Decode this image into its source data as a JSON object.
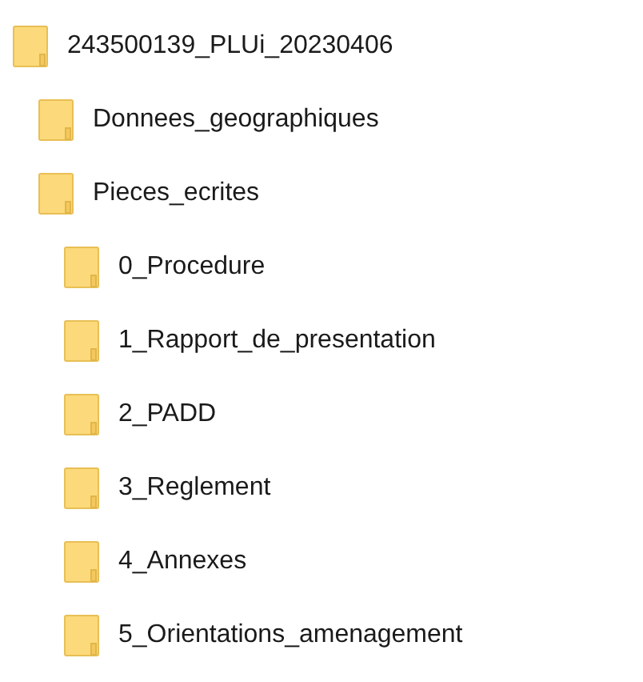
{
  "tree": [
    {
      "label": "243500139_PLUi_20230406",
      "children": [
        {
          "label": "Donnees_geographiques"
        },
        {
          "label": "Pieces_ecrites",
          "children": [
            {
              "label": "0_Procedure"
            },
            {
              "label": "1_Rapport_de_presentation"
            },
            {
              "label": "2_PADD"
            },
            {
              "label": "3_Reglement"
            },
            {
              "label": "4_Annexes"
            },
            {
              "label": "5_Orientations_amenagement"
            }
          ]
        }
      ]
    }
  ]
}
